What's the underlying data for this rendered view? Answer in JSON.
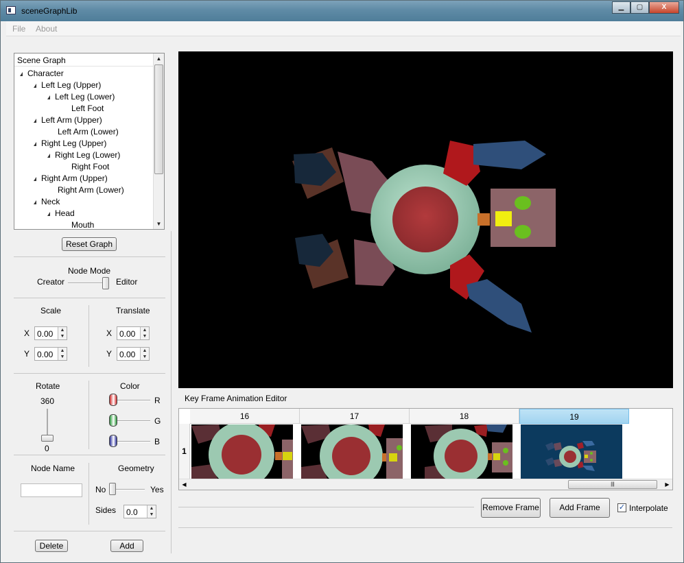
{
  "window": {
    "title": "sceneGraphLib",
    "minimize": "▁",
    "maximize": "▢",
    "close": "X"
  },
  "menu": {
    "file": "File",
    "about": "About"
  },
  "scene_graph": {
    "header": "Scene Graph",
    "items": [
      {
        "label": "Character",
        "level": 0,
        "expandable": true
      },
      {
        "label": "Left Leg (Upper)",
        "level": 1,
        "expandable": true
      },
      {
        "label": "Left Leg (Lower)",
        "level": 2,
        "expandable": true
      },
      {
        "label": "Left Foot",
        "level": 3,
        "expandable": false
      },
      {
        "label": "Left Arm (Upper)",
        "level": 1,
        "expandable": true
      },
      {
        "label": "Left Arm (Lower)",
        "level": 2,
        "expandable": false
      },
      {
        "label": "Right Leg (Upper)",
        "level": 1,
        "expandable": true
      },
      {
        "label": "Right Leg (Lower)",
        "level": 2,
        "expandable": true
      },
      {
        "label": "Right Foot",
        "level": 3,
        "expandable": false
      },
      {
        "label": "Right Arm (Upper)",
        "level": 1,
        "expandable": true
      },
      {
        "label": "Right Arm (Lower)",
        "level": 2,
        "expandable": false
      },
      {
        "label": "Neck",
        "level": 1,
        "expandable": true
      },
      {
        "label": "Head",
        "level": 2,
        "expandable": true
      },
      {
        "label": "Mouth",
        "level": 3,
        "expandable": false
      }
    ]
  },
  "reset_graph": "Reset Graph",
  "node_mode": {
    "title": "Node Mode",
    "left": "Creator",
    "right": "Editor",
    "value": 1
  },
  "scale": {
    "title": "Scale",
    "x_label": "X",
    "y_label": "Y",
    "x": "0.00",
    "y": "0.00"
  },
  "translate": {
    "title": "Translate",
    "x_label": "X",
    "y_label": "Y",
    "x": "0.00",
    "y": "0.00"
  },
  "rotate": {
    "title": "Rotate",
    "max": "360",
    "min": "0",
    "value": 0
  },
  "color": {
    "title": "Color",
    "r": "R",
    "g": "G",
    "b": "B",
    "r_value": 0,
    "g_value": 0,
    "b_value": 0,
    "r_hex": "#d22a2a",
    "g_hex": "#2a9b3a",
    "b_hex": "#2a2f9b"
  },
  "node_name": {
    "title": "Node Name",
    "value": ""
  },
  "geometry": {
    "title": "Geometry",
    "no": "No",
    "yes": "Yes",
    "sides_label": "Sides",
    "sides": "0.0",
    "value": 0
  },
  "buttons": {
    "delete": "Delete",
    "add": "Add"
  },
  "keyframes": {
    "label": "Key Frame Animation Editor",
    "row": "1",
    "columns": [
      "16",
      "17",
      "18",
      "19"
    ],
    "selected": "19"
  },
  "remove_frame": "Remove Frame",
  "add_frame": "Add Frame",
  "interpolate": {
    "label": "Interpolate",
    "checked": true,
    "mark": "✓"
  },
  "colors": {
    "body_outer": "#9cc9b1",
    "body_inner": "#9a2f32",
    "head": "#8c6468",
    "eye": "#6abf1f",
    "mouth": "#f0ee10",
    "selected_header": "#a2d4f0"
  }
}
